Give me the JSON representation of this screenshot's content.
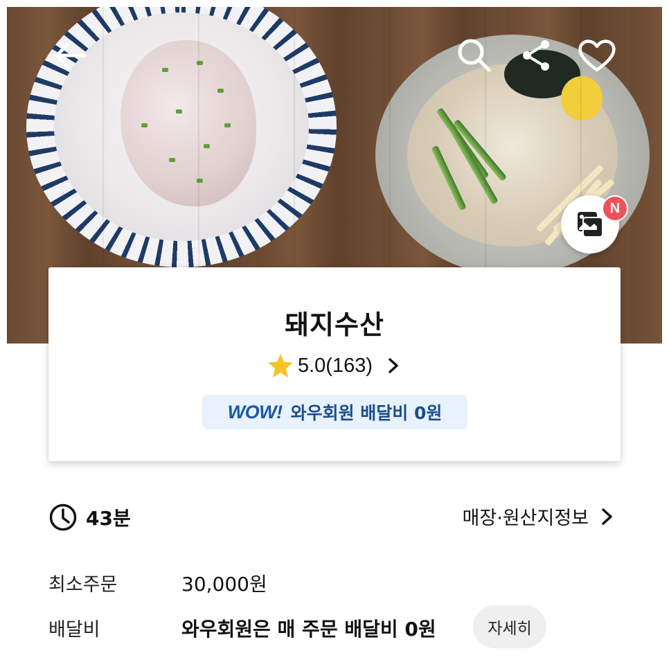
{
  "store": {
    "name": "돼지수산",
    "rating": "5.0(163)"
  },
  "header_icons": [
    "back-arrow-icon",
    "search-icon",
    "share-icon",
    "heart-icon"
  ],
  "gallery": {
    "badge": "N"
  },
  "wow": {
    "logo": "WOW!",
    "text": "와우회원 배달비 0원",
    "accent": "#1c57a5",
    "background": "#e8f2fc"
  },
  "delivery": {
    "eta": "43분",
    "origin_link": "매장·원산지정보"
  },
  "details": {
    "min_order_label": "최소주문",
    "min_order_value": "30,000원",
    "fee_label": "배달비",
    "fee_value": "와우회원은 매 주문 배달비 0원",
    "more_button": "자세히"
  },
  "colors": {
    "badge_red": "#f0525b",
    "star_yellow": "#f7c325"
  }
}
